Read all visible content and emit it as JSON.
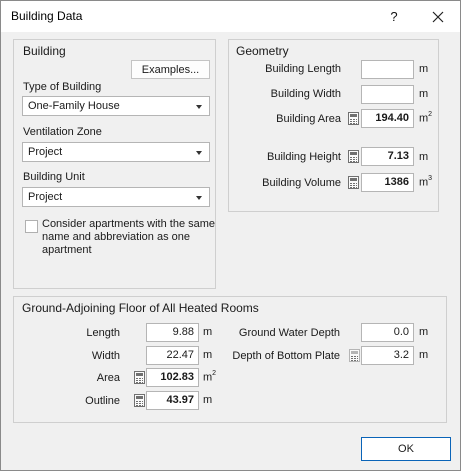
{
  "window": {
    "title": "Building Data",
    "help_label": "?"
  },
  "building": {
    "title": "Building",
    "examples_label": "Examples...",
    "type_label": "Type of Building",
    "type_value": "One-Family House",
    "ventilation_label": "Ventilation Zone",
    "ventilation_value": "Project",
    "unit_label": "Building Unit",
    "unit_value": "Project",
    "consider_label": "Consider apartments with the same name and abbreviation as one apartment",
    "consider_checked": false
  },
  "geometry": {
    "title": "Geometry",
    "length_label": "Building Length",
    "length_value": "",
    "length_unit": "m",
    "width_label": "Building Width",
    "width_value": "",
    "width_unit": "m",
    "area_label": "Building Area",
    "area_value": "194.40",
    "area_unit": "m",
    "area_unit_sup": "2",
    "height_label": "Building Height",
    "height_value": "7.13",
    "height_unit": "m",
    "volume_label": "Building Volume",
    "volume_value": "1386",
    "volume_unit": "m",
    "volume_unit_sup": "3"
  },
  "ground": {
    "title": "Ground-Adjoining Floor of All Heated Rooms",
    "length_label": "Length",
    "length_value": "9.88",
    "length_unit": "m",
    "width_label": "Width",
    "width_value": "22.47",
    "width_unit": "m",
    "area_label": "Area",
    "area_value": "102.83",
    "area_unit": "m",
    "area_unit_sup": "2",
    "outline_label": "Outline",
    "outline_value": "43.97",
    "outline_unit": "m",
    "water_label": "Ground Water Depth",
    "water_value": "0.0",
    "water_unit": "m",
    "plate_label": "Depth of Bottom Plate",
    "plate_value": "3.2",
    "plate_unit": "m"
  },
  "footer": {
    "ok_label": "OK"
  },
  "colors": {
    "accent": "#0a64b8",
    "border": "#cfcfcf",
    "background": "#f0f0f0"
  },
  "icons": [
    "close-icon",
    "calculator-icon",
    "chevron-down-icon"
  ]
}
